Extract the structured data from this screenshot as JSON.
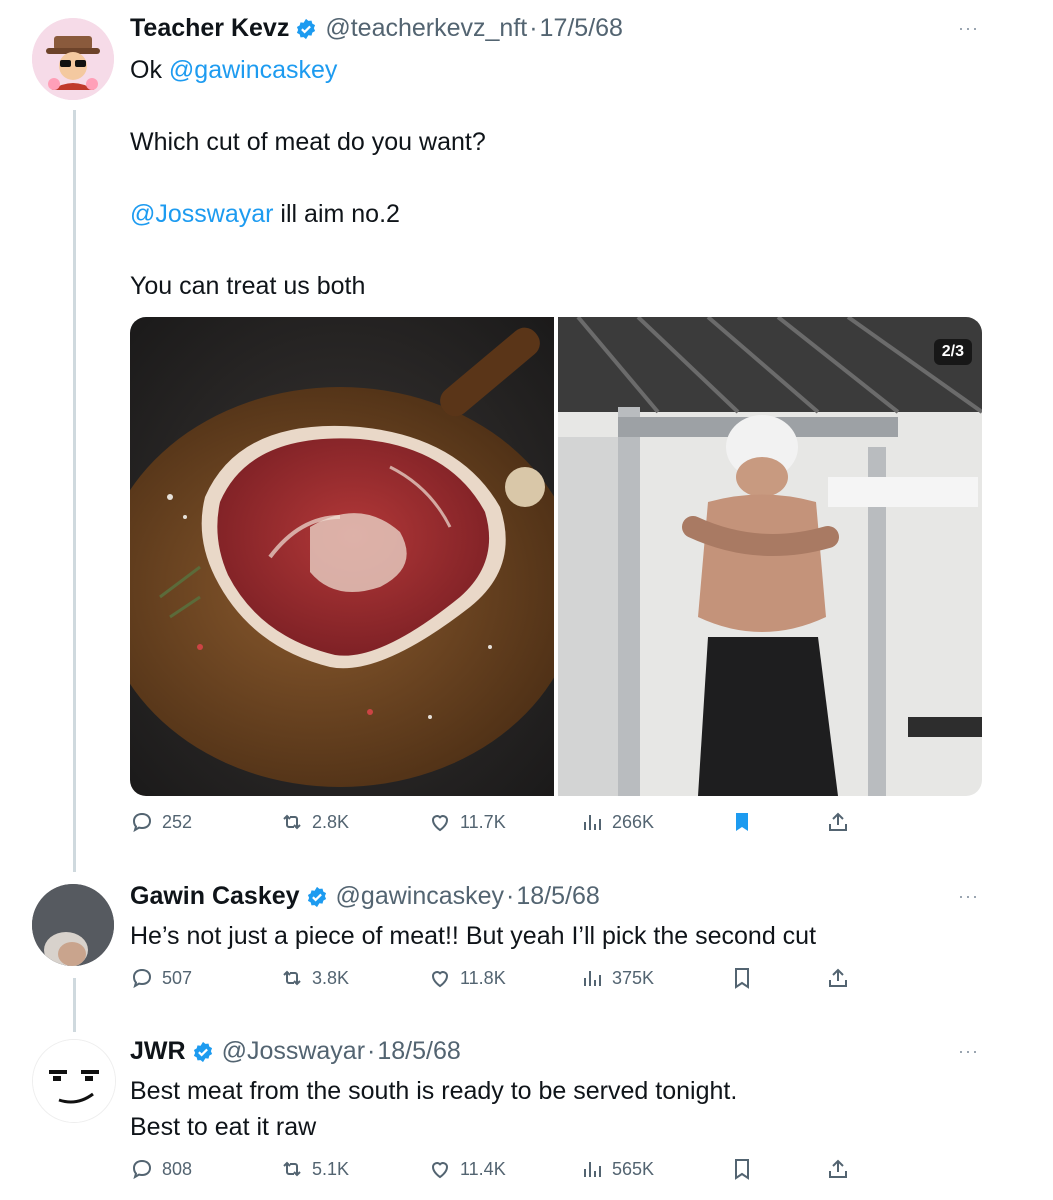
{
  "tweets": [
    {
      "name": "Teacher Kevz",
      "handle": "@teacherkevz_nft",
      "sep": "·",
      "date": "17/5/68",
      "more": "···",
      "lines": {
        "l1_prefix": "Ok ",
        "l1_mention": "@gawincaskey",
        "l2": "Which cut of meat do you want?",
        "l3_mention": "@Josswayar",
        "l3_suffix": " ill aim no.2",
        "l4": "You can treat us both"
      },
      "media_counter": "2/3",
      "stats": {
        "replies": "252",
        "reposts": "2.8K",
        "likes": "11.7K",
        "views": "266K"
      },
      "bookmarked": true
    },
    {
      "name": "Gawin Caskey",
      "handle": "@gawincaskey",
      "sep": "·",
      "date": "18/5/68",
      "more": "···",
      "text": "He’s not just a piece of meat!! But yeah I’ll pick the second cut",
      "stats": {
        "replies": "507",
        "reposts": "3.8K",
        "likes": "11.8K",
        "views": "375K"
      },
      "bookmarked": false
    },
    {
      "name": "JWR",
      "handle": "@Josswayar",
      "sep": "·",
      "date": "18/5/68",
      "more": "···",
      "text1": "Best meat from the south is ready to be served tonight.",
      "text2": "Best to eat it raw",
      "stats": {
        "replies": "808",
        "reposts": "5.1K",
        "likes": "11.4K",
        "views": "565K"
      },
      "bookmarked": false
    }
  ],
  "colors": {
    "accent": "#1d9bf0",
    "muted": "#536471",
    "text": "#0f1419"
  }
}
